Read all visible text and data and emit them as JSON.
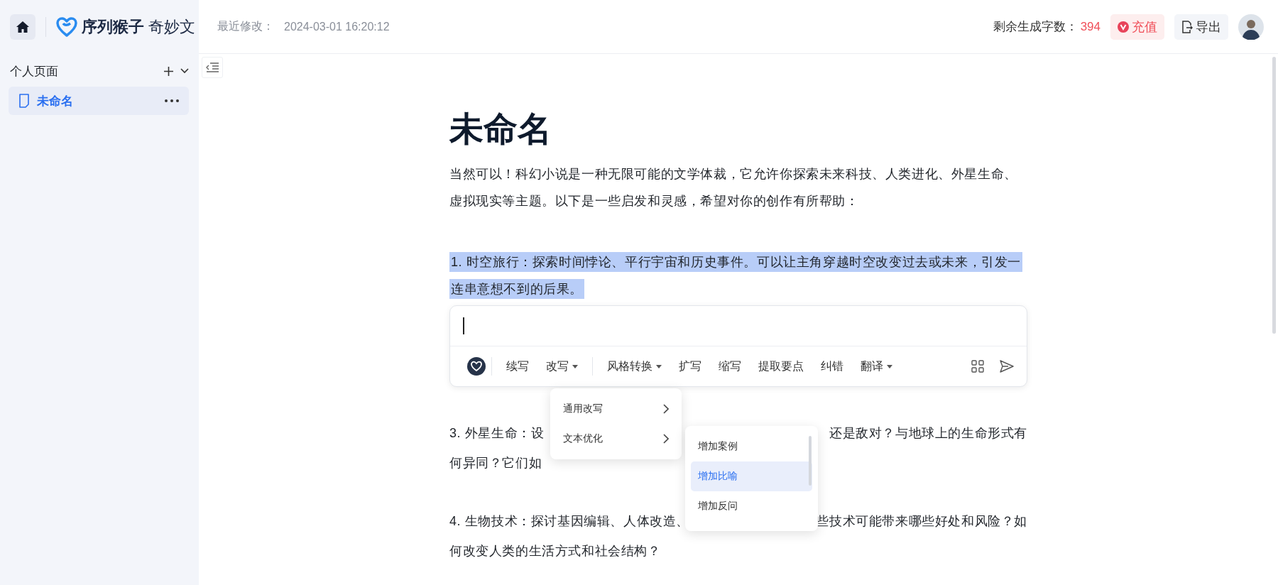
{
  "header": {
    "logo": {
      "brand": "序列猴子",
      "product": "奇妙文"
    },
    "last_modified_label": "最近修改：",
    "last_modified": "2024-03-01 16:20:12",
    "quota_label": "剩余生成字数：",
    "quota": "394",
    "recharge_button": "充值",
    "export_button": "导出"
  },
  "sidebar": {
    "section_title": "个人页面",
    "pages": [
      {
        "title": "未命名",
        "selected": true
      }
    ]
  },
  "document": {
    "title": "未命名",
    "paragraphs": [
      {
        "lines": [
          "当然可以！科幻小说是一种无限可能的文学体裁，它允许你探索未来科技、人类进化、外星生命、",
          "虚拟现实等主题。以下是一些启发和灵感，希望对你的创作有所帮助："
        ],
        "selected": false
      },
      {
        "lines": [
          "1. 时空旅行：探索时间悖论、平行宇宙和历史事件。可以让主角穿越时空改变过去或未来，引发一",
          "连串意想不到的后果。"
        ],
        "selected": true
      }
    ],
    "covered_paragraphs": [
      {
        "lines": [
          {
            "left": "3. 外星生命：设",
            "right": "还是敌对？与地球上的生命形式有"
          },
          {
            "left": "何异同？它们如"
          }
        ]
      },
      {
        "lines": [
          {
            "left": "4. 生物技术：探讨基因编辑、人体改造、",
            "right": "些技术可能带来哪些好处和风险？如"
          },
          {
            "left": "何改变人类的生活方式和社会结构？"
          }
        ]
      }
    ]
  },
  "ai_toolbar": {
    "actions": [
      {
        "label": "续写",
        "has_menu": false,
        "divider_before": false
      },
      {
        "label": "改写",
        "has_menu": true,
        "divider_before": false
      },
      {
        "label": "风格转换",
        "has_menu": true,
        "divider_before": true
      },
      {
        "label": "扩写",
        "has_menu": false,
        "divider_before": false
      },
      {
        "label": "缩写",
        "has_menu": false,
        "divider_before": false
      },
      {
        "label": "提取要点",
        "has_menu": false,
        "divider_before": false
      },
      {
        "label": "纠错",
        "has_menu": false,
        "divider_before": false
      },
      {
        "label": "翻译",
        "has_menu": true,
        "divider_before": false
      }
    ]
  },
  "rewrite_menu": {
    "items": [
      {
        "label": "通用改写",
        "selected": false
      },
      {
        "label": "文本优化",
        "selected": false
      }
    ]
  },
  "optimize_submenu": {
    "items": [
      {
        "label": "增加案例",
        "selected": false
      },
      {
        "label": "增加比喻",
        "selected": true
      },
      {
        "label": "增加反问",
        "selected": false
      }
    ]
  }
}
